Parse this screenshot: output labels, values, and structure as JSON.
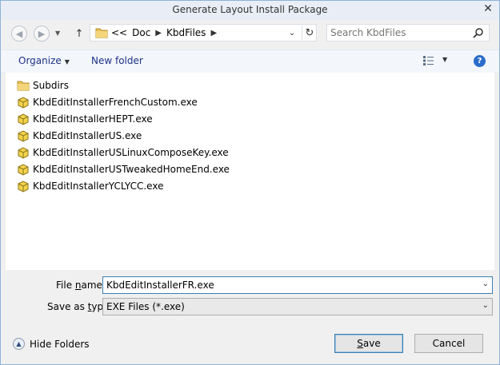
{
  "window": {
    "title": "Generate Layout Install Package"
  },
  "address": {
    "prefix": "<<",
    "crumbs": [
      "Doc",
      "KbdFiles"
    ]
  },
  "search": {
    "placeholder": "Search KbdFiles"
  },
  "toolbar": {
    "organize": "Organize",
    "new_folder": "New folder"
  },
  "files": [
    {
      "name": "Subdirs",
      "type": "folder"
    },
    {
      "name": "KbdEditInstallerFrenchCustom.exe",
      "type": "package"
    },
    {
      "name": "KbdEditInstallerHEPT.exe",
      "type": "package"
    },
    {
      "name": "KbdEditInstallerUS.exe",
      "type": "package"
    },
    {
      "name": "KbdEditInstallerUSLinuxComposeKey.exe",
      "type": "package"
    },
    {
      "name": "KbdEditInstallerUSTweakedHomeEnd.exe",
      "type": "package"
    },
    {
      "name": "KbdEditInstallerYCLYCC.exe",
      "type": "package"
    }
  ],
  "form": {
    "file_name_label_pre": "File ",
    "file_name_label_ul": "n",
    "file_name_label_post": "ame:",
    "file_name_value": "KbdEditInstallerFR.exe",
    "save_type_label_pre": "Save as ",
    "save_type_label_ul": "t",
    "save_type_label_post": "ype:",
    "save_type_value": "EXE Files (*.exe)"
  },
  "footer": {
    "hide_folders": "Hide Folders",
    "save_ul": "S",
    "save_rest": "ave",
    "cancel": "Cancel"
  }
}
